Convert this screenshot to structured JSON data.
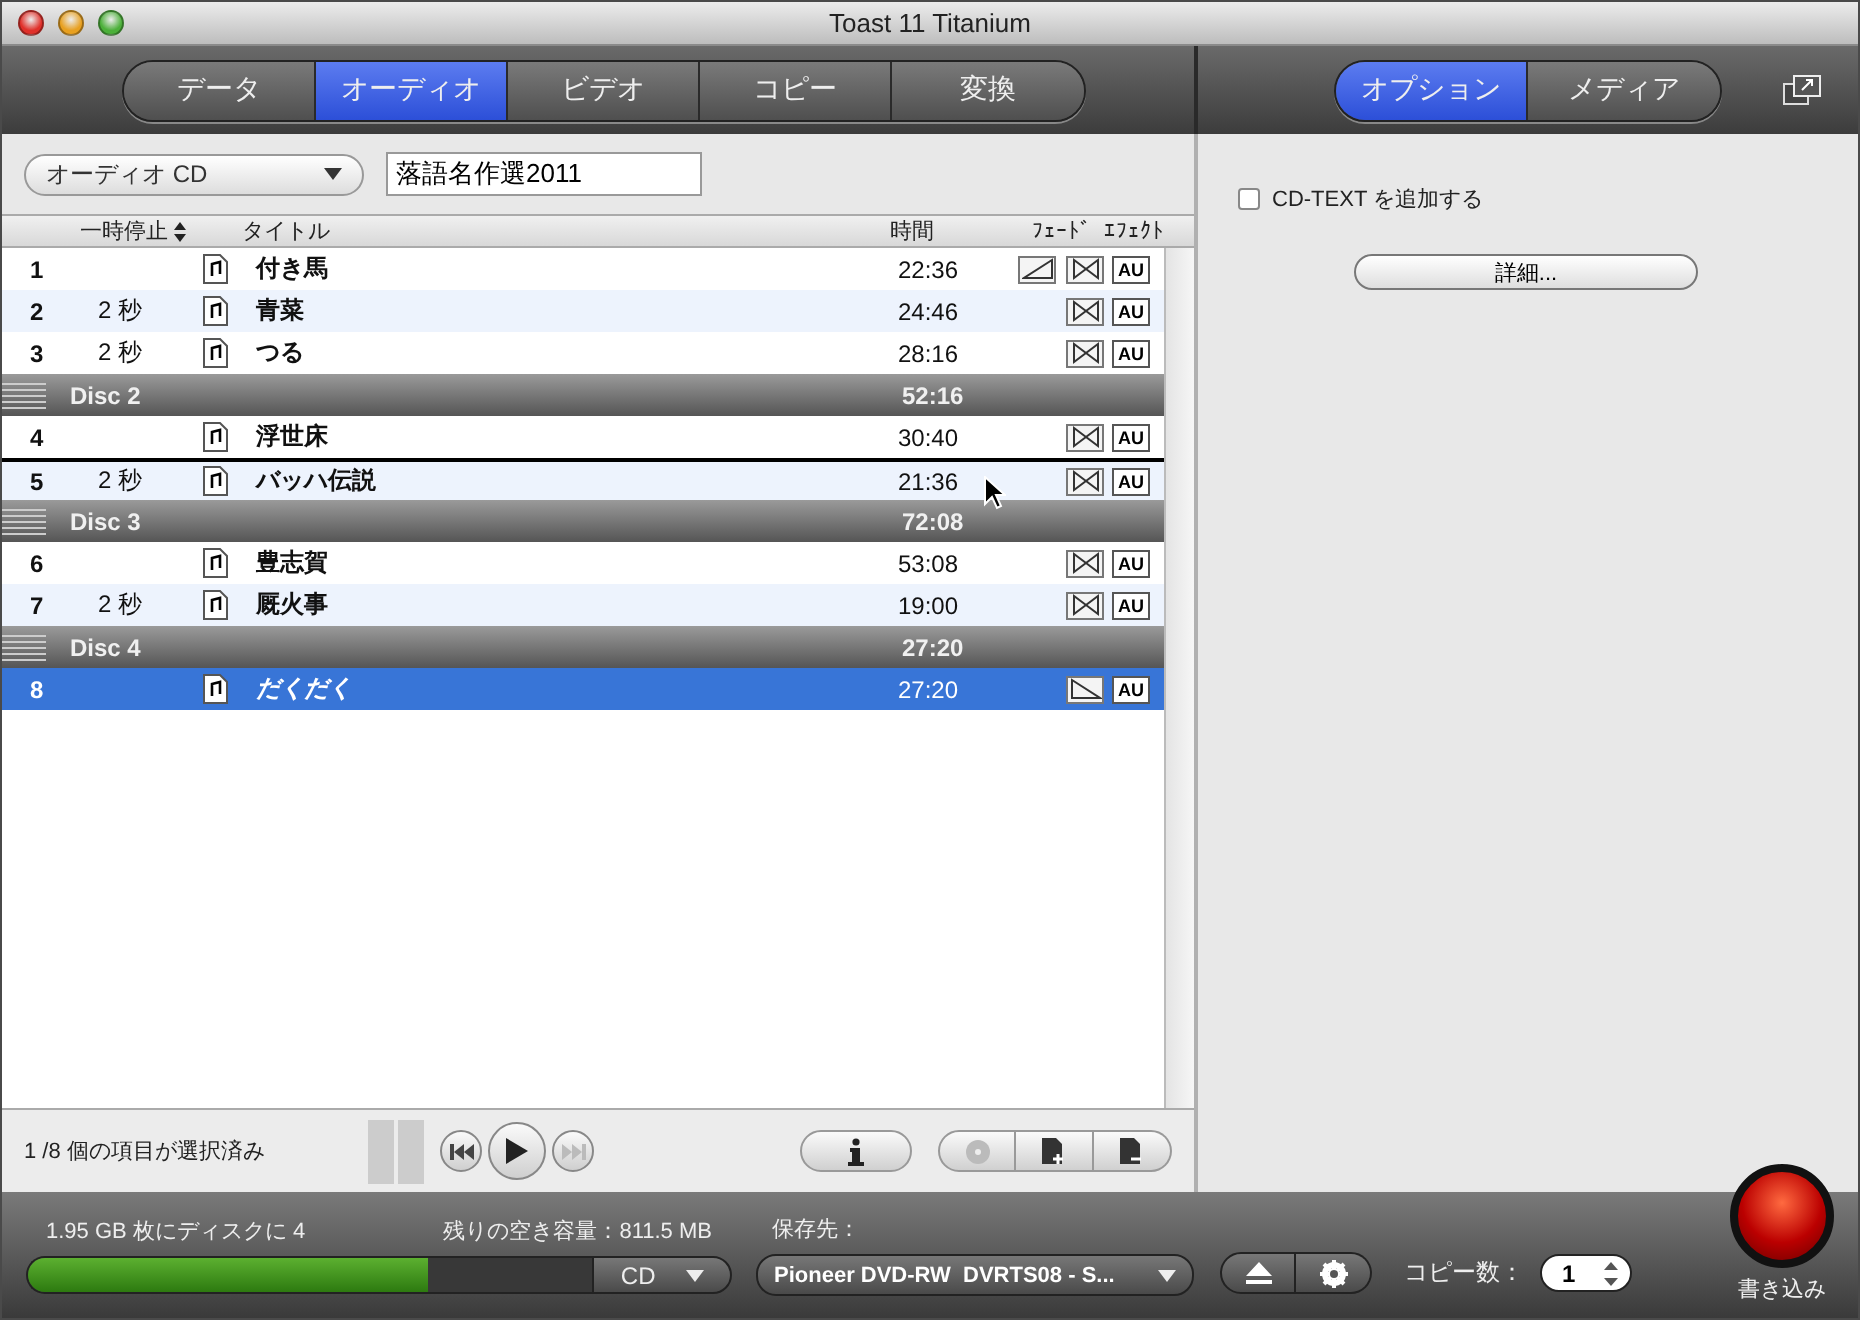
{
  "window": {
    "title": "Toast 11 Titanium"
  },
  "main_tabs": [
    {
      "label": "データ",
      "selected": false
    },
    {
      "label": "オーディオ",
      "selected": true
    },
    {
      "label": "ビデオ",
      "selected": false
    },
    {
      "label": "コピー",
      "selected": false
    },
    {
      "label": "変換",
      "selected": false
    }
  ],
  "side_tabs": [
    {
      "label": "オプション",
      "selected": true
    },
    {
      "label": "メディア",
      "selected": false
    }
  ],
  "format_dropdown": {
    "value": "オーディオ CD"
  },
  "disc_title": {
    "value": "落語名作選2011"
  },
  "table": {
    "columns": [
      "一時停止",
      "タイトル",
      "時間",
      "ﾌｪｰﾄﾞ",
      "ｴﾌｪｸﾄ"
    ],
    "rows": [
      {
        "kind": "track",
        "number": "1",
        "pause": "",
        "title": "付き馬",
        "time": "22:36",
        "fades": [
          {
            "kind": "in"
          },
          {
            "kind": "cross"
          }
        ],
        "effect": "AU",
        "selected": false
      },
      {
        "kind": "track",
        "number": "2",
        "pause": "2 秒",
        "title": "青菜",
        "time": "24:46",
        "fades": [
          {
            "kind": "cross"
          }
        ],
        "effect": "AU",
        "selected": false
      },
      {
        "kind": "track",
        "number": "3",
        "pause": "2 秒",
        "title": "つる",
        "time": "28:16",
        "fades": [
          {
            "kind": "cross"
          }
        ],
        "effect": "AU",
        "selected": false
      },
      {
        "kind": "disc",
        "label": "Disc 2",
        "time": "52:16"
      },
      {
        "kind": "track",
        "number": "4",
        "pause": "",
        "title": "浮世床",
        "time": "30:40",
        "fades": [
          {
            "kind": "cross"
          }
        ],
        "effect": "AU",
        "selected": false
      },
      {
        "kind": "track",
        "number": "5",
        "pause": "2 秒",
        "title": "バッハ伝説",
        "time": "21:36",
        "fades": [
          {
            "kind": "cross"
          }
        ],
        "effect": "AU",
        "selected": false
      },
      {
        "kind": "disc",
        "label": "Disc 3",
        "time": "72:08"
      },
      {
        "kind": "track",
        "number": "6",
        "pause": "",
        "title": "豊志賀",
        "time": "53:08",
        "fades": [
          {
            "kind": "cross"
          }
        ],
        "effect": "AU",
        "selected": false
      },
      {
        "kind": "track",
        "number": "7",
        "pause": "2 秒",
        "title": "厩火事",
        "time": "19:00",
        "fades": [
          {
            "kind": "cross"
          }
        ],
        "effect": "AU",
        "selected": false
      },
      {
        "kind": "disc",
        "label": "Disc 4",
        "time": "27:20"
      },
      {
        "kind": "track",
        "number": "8",
        "pause": "",
        "title": "だくだく",
        "time": "27:20",
        "fades": [
          {
            "kind": "out"
          }
        ],
        "effect": "AU",
        "selected": true
      }
    ]
  },
  "status": "1 /8 個の項目が選択済み",
  "options": {
    "cd_text": {
      "label": "CD-TEXT を追加する",
      "checked": false
    },
    "details_button": "詳細..."
  },
  "bottom_bar": {
    "capacity_label": "1.95 GB 枚にディスクに 4",
    "free_label": "残りの空き容量：811.5 MB",
    "capacity": {
      "level": 0.71
    },
    "media": "CD",
    "destination_label": "保存先：",
    "destination": "Pioneer DVD-RW  DVRTS08 - S...",
    "copies_label": "コピー数：",
    "copies": "1",
    "burn_label": "書き込み"
  }
}
